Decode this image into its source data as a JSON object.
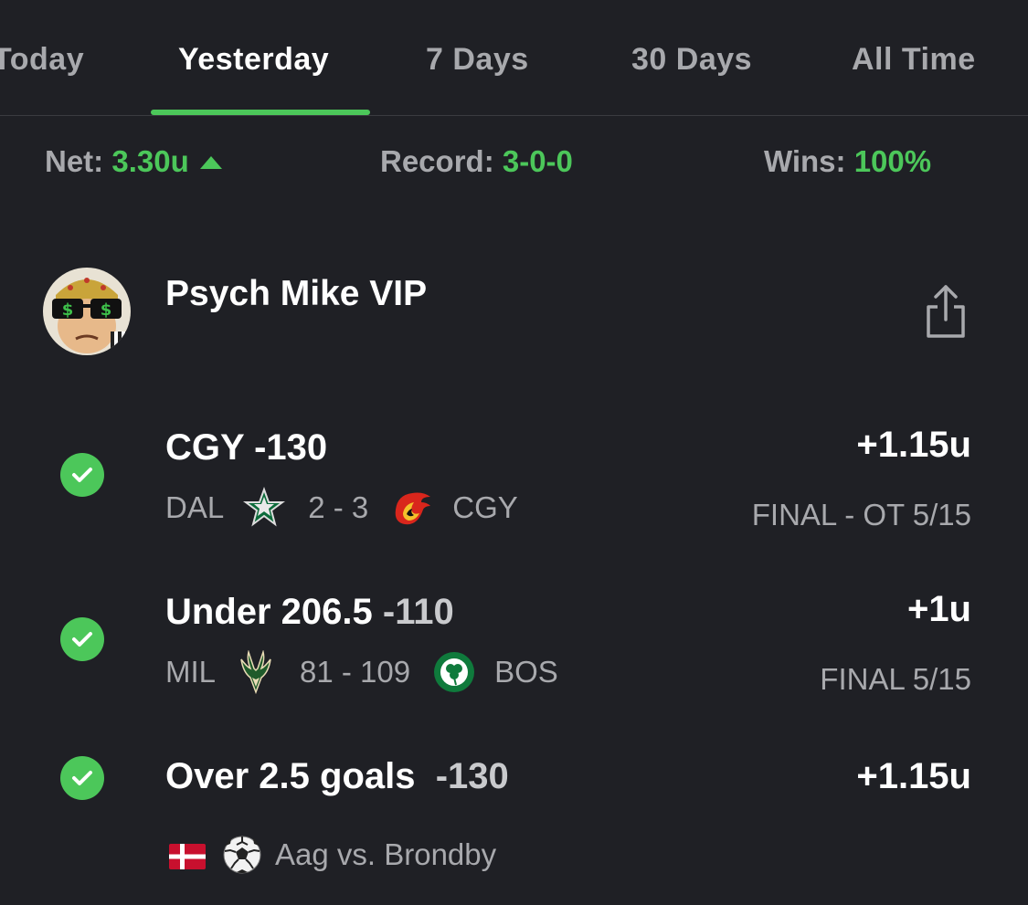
{
  "tabs": [
    {
      "label": "Today"
    },
    {
      "label": "Yesterday"
    },
    {
      "label": "7 Days"
    },
    {
      "label": "30 Days"
    },
    {
      "label": "All Time"
    }
  ],
  "active_tab": "Yesterday",
  "stats": {
    "net_label": "Net:",
    "net_value": "3.30u",
    "record_label": "Record:",
    "record_value": "3-0-0",
    "wins_label": "Wins:",
    "wins_value": "100%"
  },
  "profile": {
    "name": "Psych Mike  VIP"
  },
  "bets": [
    {
      "pick": "CGY -130",
      "result": "+1.15u",
      "status": "FINAL - OT 5/15",
      "away_team": "DAL",
      "score": "2 - 3",
      "home_team": "CGY",
      "away_logo": "dallas-stars-logo-icon",
      "home_logo": "calgary-flames-logo-icon"
    },
    {
      "pick": "Under 206.5",
      "odds": "-110",
      "result": "+1u",
      "status": "FINAL 5/15",
      "away_team": "MIL",
      "score": "81 - 109",
      "home_team": "BOS",
      "away_logo": "milwaukee-bucks-logo-icon",
      "home_logo": "boston-celtics-logo-icon"
    },
    {
      "pick": "Over 2.5 goals",
      "odds": "-130",
      "result": "+1.15u",
      "matchup": "Aag vs. Brondby",
      "flag": "denmark-flag-icon",
      "sport": "soccer-ball-icon"
    }
  ],
  "colors": {
    "background": "#1f2025",
    "accent_green": "#4cc75a",
    "muted_text": "#a8a9ad"
  }
}
